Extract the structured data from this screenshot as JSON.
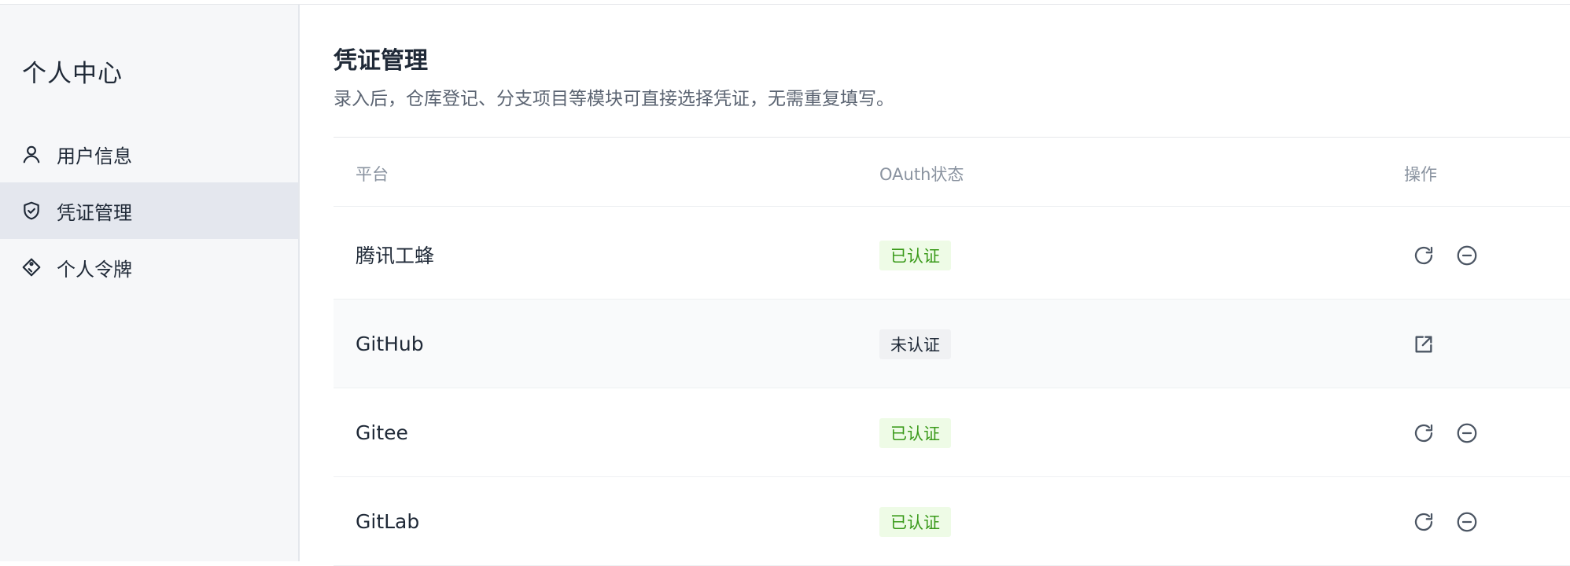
{
  "sidebar": {
    "title": "个人中心",
    "items": [
      {
        "label": "用户信息",
        "icon": "user-icon",
        "active": false
      },
      {
        "label": "凭证管理",
        "icon": "shield-check-icon",
        "active": true
      },
      {
        "label": "个人令牌",
        "icon": "tag-icon",
        "active": false
      }
    ]
  },
  "main": {
    "title": "凭证管理",
    "description": "录入后，仓库登记、分支项目等模块可直接选择凭证，无需重复填写。",
    "table": {
      "headers": {
        "platform": "平台",
        "oauth_status": "OAuth状态",
        "actions": "操作"
      },
      "rows": [
        {
          "platform": "腾讯工蜂",
          "status": "已认证",
          "authenticated": true,
          "actions": [
            "refresh-icon",
            "remove-circle-icon"
          ]
        },
        {
          "platform": "GitHub",
          "status": "未认证",
          "authenticated": false,
          "actions": [
            "external-link-icon"
          ]
        },
        {
          "platform": "Gitee",
          "status": "已认证",
          "authenticated": true,
          "actions": [
            "refresh-icon",
            "remove-circle-icon"
          ]
        },
        {
          "platform": "GitLab",
          "status": "已认证",
          "authenticated": true,
          "actions": [
            "refresh-icon",
            "remove-circle-icon"
          ]
        }
      ]
    }
  },
  "colors": {
    "sidebar_bg": "#f6f7f9",
    "active_item_bg": "#e4e7ee",
    "badge_ok_bg": "#eefbe6",
    "badge_ok_text": "#3a9a1a",
    "badge_no_bg": "#f0f1f3",
    "icon_color": "#4b5563"
  }
}
